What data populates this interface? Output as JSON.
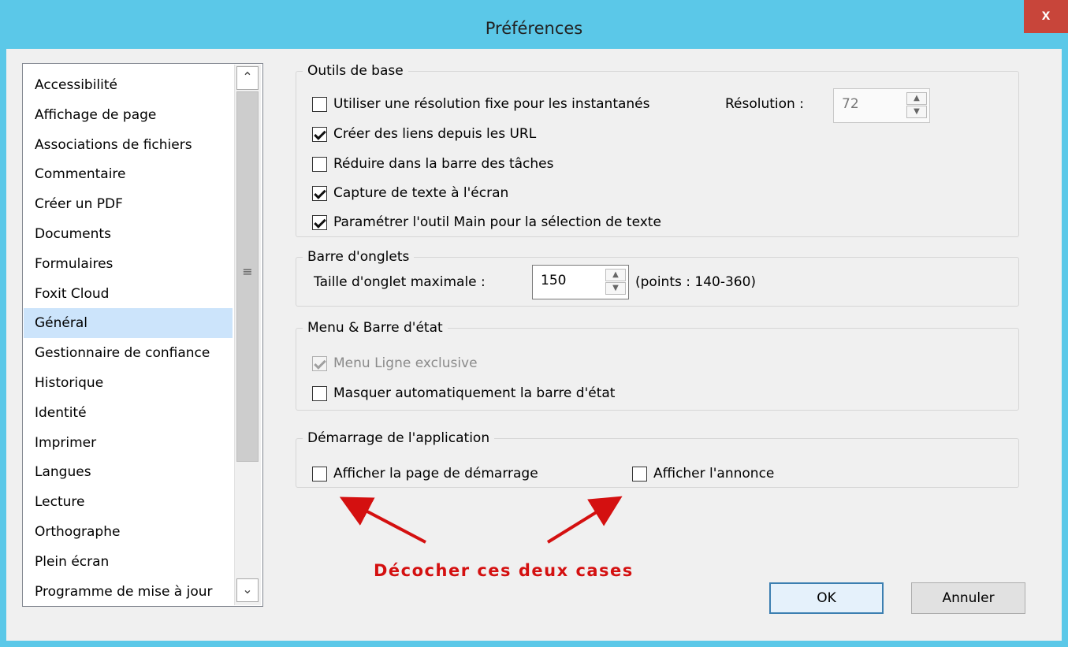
{
  "window": {
    "title": "Préférences",
    "close_label": "x",
    "title_bg": "#5bc8e8",
    "close_bg": "#c8453a"
  },
  "categories": [
    {
      "label": "Accessibilité"
    },
    {
      "label": "Affichage de page"
    },
    {
      "label": "Associations de fichiers"
    },
    {
      "label": "Commentaire"
    },
    {
      "label": "Créer un PDF"
    },
    {
      "label": "Documents"
    },
    {
      "label": "Formulaires"
    },
    {
      "label": "Foxit Cloud"
    },
    {
      "label": "Général",
      "selected": true
    },
    {
      "label": "Gestionnaire de confiance"
    },
    {
      "label": "Historique"
    },
    {
      "label": "Identité"
    },
    {
      "label": "Imprimer"
    },
    {
      "label": "Langues"
    },
    {
      "label": "Lecture"
    },
    {
      "label": "Orthographe"
    },
    {
      "label": "Plein écran"
    },
    {
      "label": "Programme de mise à jour"
    }
  ],
  "scrollbar": {
    "up": "⌃",
    "down": "⌄",
    "grip": "≡"
  },
  "groups": {
    "basic_tools": {
      "title": "Outils de base",
      "fixed_resolution": {
        "label": "Utiliser une résolution fixe pour les instantanés",
        "checked": false
      },
      "resolution_label": "Résolution :",
      "resolution_value": "72",
      "create_links": {
        "label": "Créer des liens depuis les URL",
        "checked": true
      },
      "minimize_taskbar": {
        "label": "Réduire dans la barre des tâches",
        "checked": false
      },
      "screen_capture": {
        "label": "Capture de texte à l'écran",
        "checked": true
      },
      "hand_tool": {
        "label": "Paramétrer l'outil Main pour la sélection de texte",
        "checked": true
      }
    },
    "tab_bar": {
      "title": "Barre d'onglets",
      "max_tab_label": "Taille d'onglet maximale :",
      "max_tab_value": "150",
      "range_hint": "(points : 140-360)"
    },
    "menu_status": {
      "title": "Menu & Barre d'état",
      "single_line_menu": {
        "label": "Menu Ligne exclusive",
        "checked": true,
        "disabled": true
      },
      "autohide_status": {
        "label": "Masquer automatiquement la barre d'état",
        "checked": false
      }
    },
    "startup": {
      "title": "Démarrage de l'application",
      "show_start_page": {
        "label": "Afficher la page de démarrage",
        "checked": false
      },
      "show_ad": {
        "label": "Afficher l'annonce",
        "checked": false
      }
    }
  },
  "annotation": {
    "text": "Décocher ces deux cases",
    "color": "#d41010"
  },
  "buttons": {
    "ok": "OK",
    "cancel": "Annuler"
  }
}
